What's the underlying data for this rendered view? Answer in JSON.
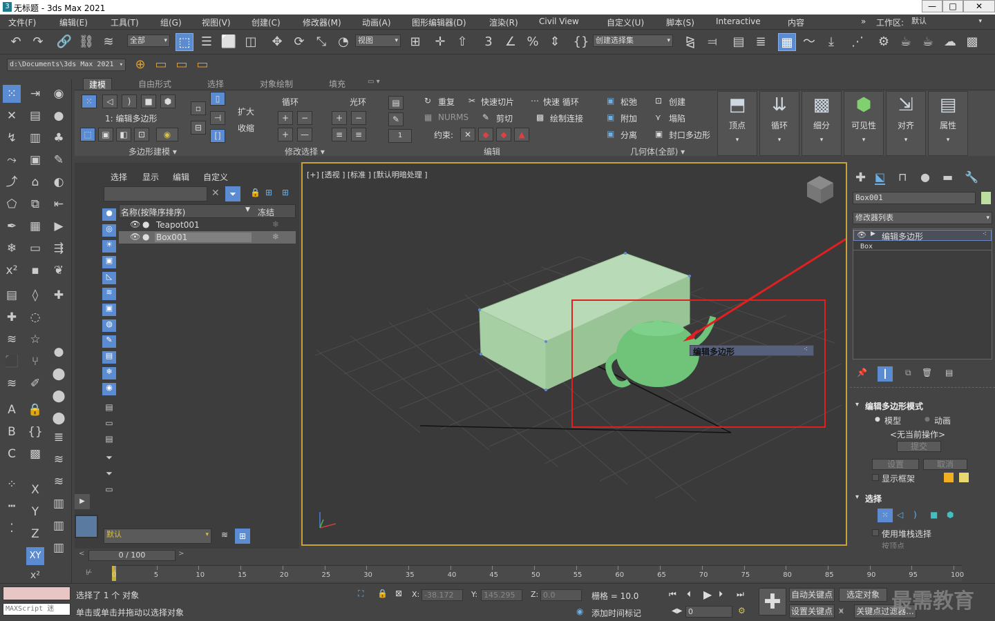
{
  "window": {
    "title": "无标题 - 3ds Max 2021",
    "min": "—",
    "max": "□",
    "close": "✕"
  },
  "menu": [
    "文件(F)",
    "编辑(E)",
    "工具(T)",
    "组(G)",
    "视图(V)",
    "创建(C)",
    "修改器(M)",
    "动画(A)",
    "图形编辑器(D)",
    "渲染(R)",
    "Civil View",
    "自定义(U)",
    "脚本(S)",
    "Interactive",
    "内容"
  ],
  "workspace": {
    "label": "工作区:",
    "value": "默认"
  },
  "toolbar": {
    "filter": "全部",
    "refcoord": "视图",
    "selset": "创建选择集",
    "path": "d:\\Documents\\3ds Max 2021"
  },
  "ribbon": {
    "tabs": [
      "建模",
      "自由形式",
      "选择",
      "对象绘制",
      "填充"
    ],
    "groups": [
      "多边形建模 ▾",
      "修改选择 ▾",
      "编辑",
      "几何体(全部) ▾"
    ],
    "polymode": "1: 编辑多边形",
    "expand": "扩大",
    "shrink": "收缩",
    "loop": "循环",
    "ring": "光环",
    "repeat": "重复",
    "quickslice": "快速切片",
    "quickloop": "快速 循环",
    "nurms": "NURMS",
    "cut": "剪切",
    "paintconnect": "绘制连接",
    "constrain": "约束:",
    "constrain_val": "1",
    "relax": "松弛",
    "create": "创建",
    "attach": "附加",
    "collapse": "塌陷",
    "detach": "分离",
    "capholes": "封口多边形",
    "big": [
      "顶点",
      "循环",
      "细分",
      "可见性",
      "对齐",
      "属性"
    ]
  },
  "scene_explorer": {
    "menu": [
      "选择",
      "显示",
      "编辑",
      "自定义"
    ],
    "col_name": "名称(按降序排序)",
    "col_freeze": "冻结",
    "rows": [
      "Teapot001",
      "Box001"
    ],
    "layer": "默认"
  },
  "viewport": {
    "label": "[+] [透视 ] [标准 ] [默认明暗处理 ]",
    "overlay": "编辑多边形"
  },
  "command_panel": {
    "object_name": "Box001",
    "modlist": "修改器列表",
    "stack": [
      "编辑多边形",
      "Box"
    ],
    "rollout1": "编辑多边形模式",
    "model": "模型",
    "animate": "动画",
    "nocurrent": "<无当前操作>",
    "commit": "提交",
    "settings": "设置",
    "cancel": "取消",
    "showcage": "显示框架",
    "rollout2": "选择",
    "usestack": "使用堆栈选择",
    "byvertex": "按顶点"
  },
  "timeline": {
    "frame": "0 / 100",
    "ticks": [
      "0",
      "5",
      "10",
      "15",
      "20",
      "25",
      "30",
      "35",
      "40",
      "45",
      "50",
      "55",
      "60",
      "65",
      "70",
      "75",
      "80",
      "85",
      "90",
      "95",
      "100"
    ]
  },
  "status": {
    "selected": "选择了 1 个 对象",
    "prompt": "单击或单击并拖动以选择对象",
    "maxscript": "MAXScript 迷",
    "x_label": "X:",
    "x": "-38.172",
    "y_label": "Y:",
    "y": "145.295",
    "z_label": "Z:",
    "z": "0.0",
    "grid": "栅格 = 10.0",
    "addtime": "添加时间标记",
    "autokey": "自动关键点",
    "selobj": "选定对象",
    "setkey": "设置关键点",
    "keyfilter": "关键点过滤器...",
    "framefield": "0",
    "watermark": "最需教育"
  }
}
